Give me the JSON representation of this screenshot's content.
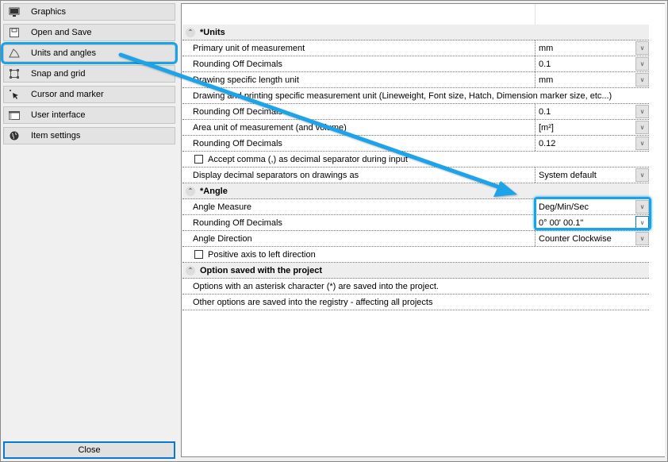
{
  "sidebar": {
    "items": [
      {
        "label": "Graphics",
        "icon": "monitor-icon"
      },
      {
        "label": "Open and Save",
        "icon": "floppy-disk-icon"
      },
      {
        "label": "Units and angles",
        "icon": "angle-icon",
        "selected": true
      },
      {
        "label": "Snap and grid",
        "icon": "snap-grid-icon"
      },
      {
        "label": "Cursor and marker",
        "icon": "cursor-icon"
      },
      {
        "label": "User interface",
        "icon": "window-icon"
      },
      {
        "label": "Item settings",
        "icon": "globe-icon"
      }
    ],
    "close_label": "Close"
  },
  "properties": {
    "units_section": "*Units",
    "primary_unit_label": "Primary unit of measurement",
    "primary_unit_value": "mm",
    "rounding1_label": "Rounding Off Decimals",
    "rounding1_value": "0.1",
    "drawing_length_label": "Drawing specific length unit",
    "drawing_length_value": "mm",
    "drawing_printing_label": "Drawing and printing specific measurement unit (Lineweight, Font size, Hatch, Dimension marker size, etc...)",
    "rounding2_label": "Rounding Off Decimals",
    "rounding2_value": "0.1",
    "area_unit_label": "Area unit of measurement (and volume)",
    "area_unit_value": "[m²]",
    "rounding3_label": "Rounding Off Decimals",
    "rounding3_value": "0.12",
    "accept_comma_label": "Accept comma (,) as decimal separator during input",
    "accept_comma_checked": false,
    "display_sep_label": "Display decimal separators on drawings as",
    "display_sep_value": "System default",
    "angle_section": "*Angle",
    "angle_measure_label": "Angle Measure",
    "angle_measure_value": "Deg/Min/Sec",
    "angle_rounding_label": "Rounding Off Decimals",
    "angle_rounding_value": "0° 00' 00.1\"",
    "angle_direction_label": "Angle Direction",
    "angle_direction_value": "Counter Clockwise",
    "positive_axis_label": "Positive axis to left direction",
    "positive_axis_checked": false,
    "saved_section": "Option saved with the project",
    "note1": "Options with an asterisk character (*) are saved into the project.",
    "note2": "Other options are saved into the registry - affecting all projects"
  },
  "annotation": {
    "accent_color": "#1aa3e8"
  }
}
